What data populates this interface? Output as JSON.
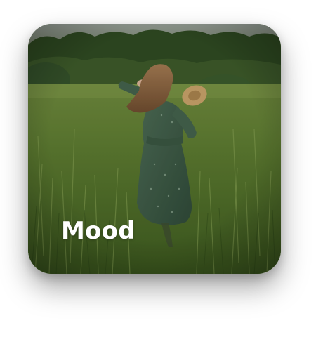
{
  "tile": {
    "label": "Mood",
    "image": "woman-in-wheat-field-photo",
    "label_color": "#ffffff"
  }
}
